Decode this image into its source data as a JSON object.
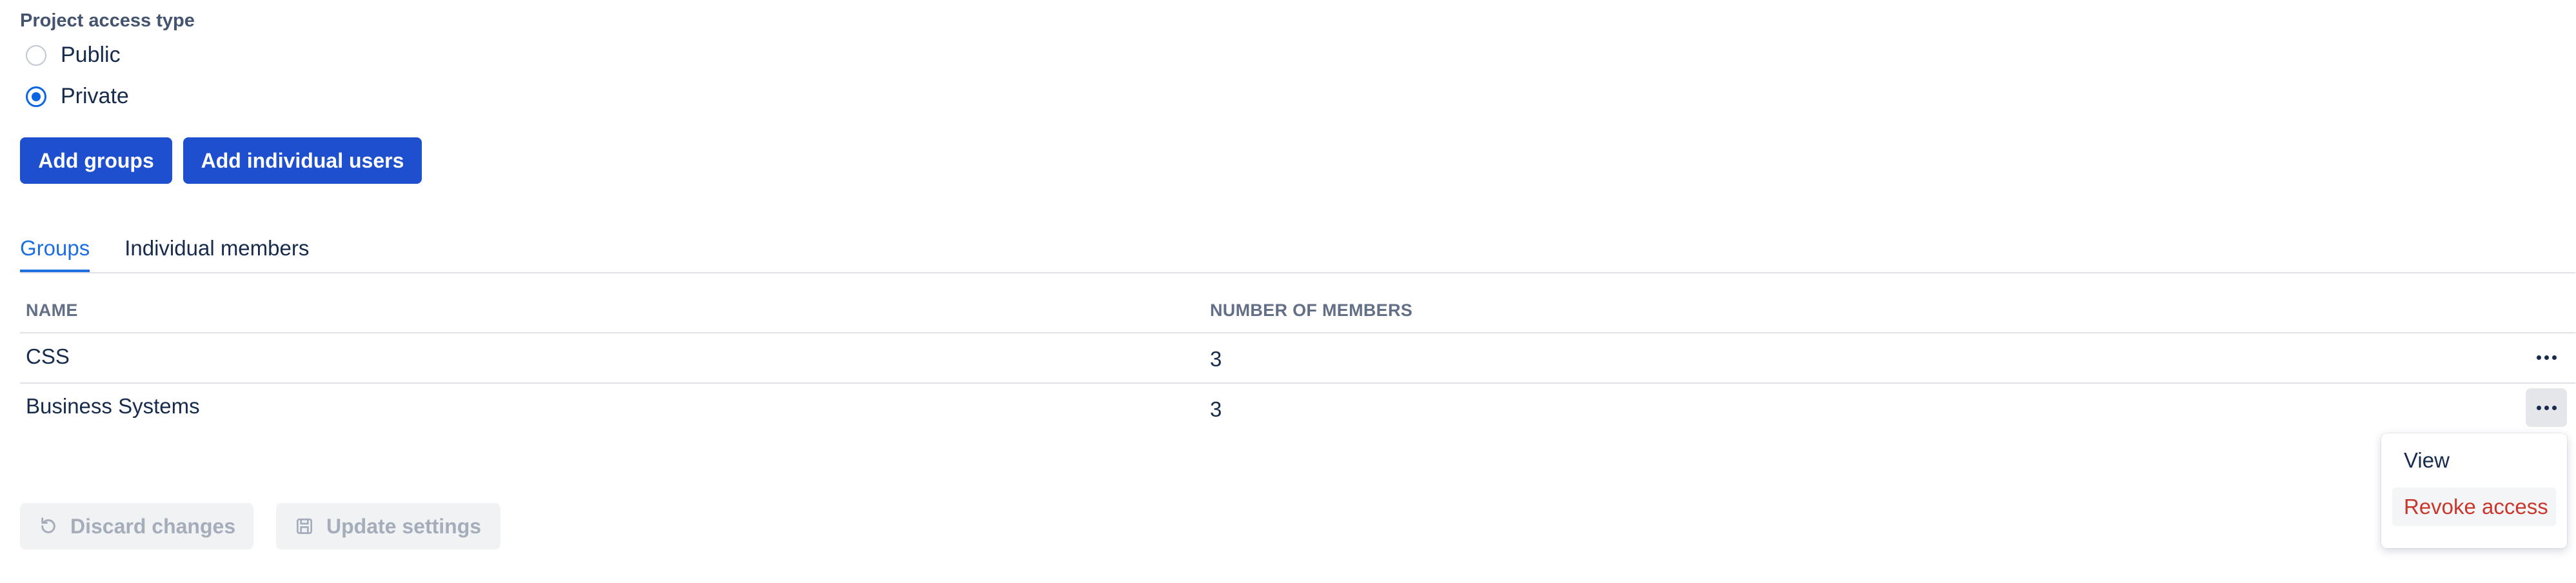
{
  "access": {
    "section_label": "Project access type",
    "options": [
      {
        "label": "Public",
        "checked": false
      },
      {
        "label": "Private",
        "checked": true
      }
    ]
  },
  "actions": {
    "add_groups": "Add groups",
    "add_individual_users": "Add individual users"
  },
  "tabs": [
    {
      "label": "Groups",
      "active": true
    },
    {
      "label": "Individual members",
      "active": false
    }
  ],
  "table": {
    "columns": [
      "NAME",
      "NUMBER OF MEMBERS"
    ],
    "rows": [
      {
        "name": "CSS",
        "members": "3"
      },
      {
        "name": "Business Systems",
        "members": "3"
      }
    ]
  },
  "row_menu": {
    "items": [
      "View",
      "Revoke access"
    ]
  },
  "footer": {
    "discard": "Discard changes",
    "update": "Update settings"
  },
  "colors": {
    "primary": "#1d4fcf",
    "tab_active": "#1d6fe0",
    "danger": "#c9372c",
    "disabled_text": "#a5adba"
  },
  "icons": {
    "more": "more-horizontal-icon",
    "discard": "undo-icon",
    "update": "save-icon"
  }
}
